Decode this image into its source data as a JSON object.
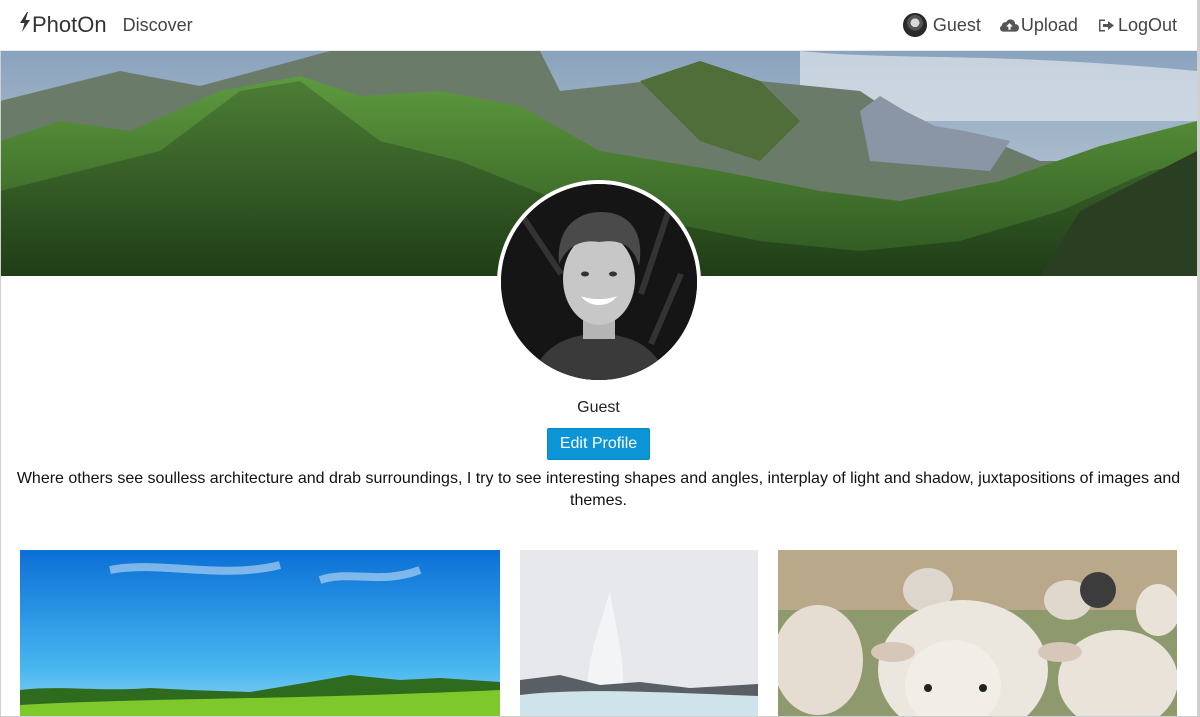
{
  "navbar": {
    "brand": "PhotOn",
    "discover": "Discover",
    "user": "Guest",
    "upload": "Upload",
    "logout": "LogOut"
  },
  "profile": {
    "name": "Guest",
    "edit_button": "Edit Profile",
    "bio": "Where others see soulless architecture and drab surroundings, I try to see interesting shapes and angles, interplay of light and shadow, juxtapositions of images and themes."
  },
  "icons": {
    "brand": "lightning-bolt-icon",
    "upload": "cloud-upload-icon",
    "logout": "logout-icon"
  },
  "colors": {
    "accent": "#0b94d6"
  }
}
